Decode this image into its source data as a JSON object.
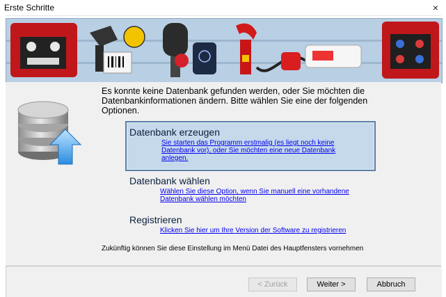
{
  "window": {
    "title": "Erste Schritte",
    "close_glyph": "×"
  },
  "banner": {
    "image": "instrument-banner"
  },
  "intro_text": "Es konnte keine Datenbank gefunden werden, oder Sie möchten die Datenbankinformationen ändern. Bitte wählen Sie eine der folgenden Optionen.",
  "options": [
    {
      "title": "Datenbank erzeugen",
      "description": "Sie starten das Programm erstmalig (es liegt noch keine Datenbank vor), oder Sie möchten eine neue Datenbank anlegen.",
      "selected": true
    },
    {
      "title": "Datenbank wählen",
      "description": "Wählen Sie diese Option, wenn Sie manuell eine vorhandene Datenbank wählen möchten",
      "selected": false
    },
    {
      "title": "Registrieren",
      "description": "Klicken Sie hier um Ihre Version der Software zu registrieren",
      "selected": false
    }
  ],
  "footer_note": "Zukünftig können Sie diese Einstellung im Menü Datei des Hauptfensters vornehmen",
  "buttons": {
    "back": "< Zurück",
    "next": "Weiter >",
    "cancel": "Abbruch"
  },
  "icons": {
    "database": "database-upload-icon",
    "close": "close-icon"
  },
  "colors": {
    "selection_bg": "#c5d9ea",
    "selection_border": "#5b7fa6",
    "link": "#0000ee",
    "arrow": "#3399ee"
  }
}
